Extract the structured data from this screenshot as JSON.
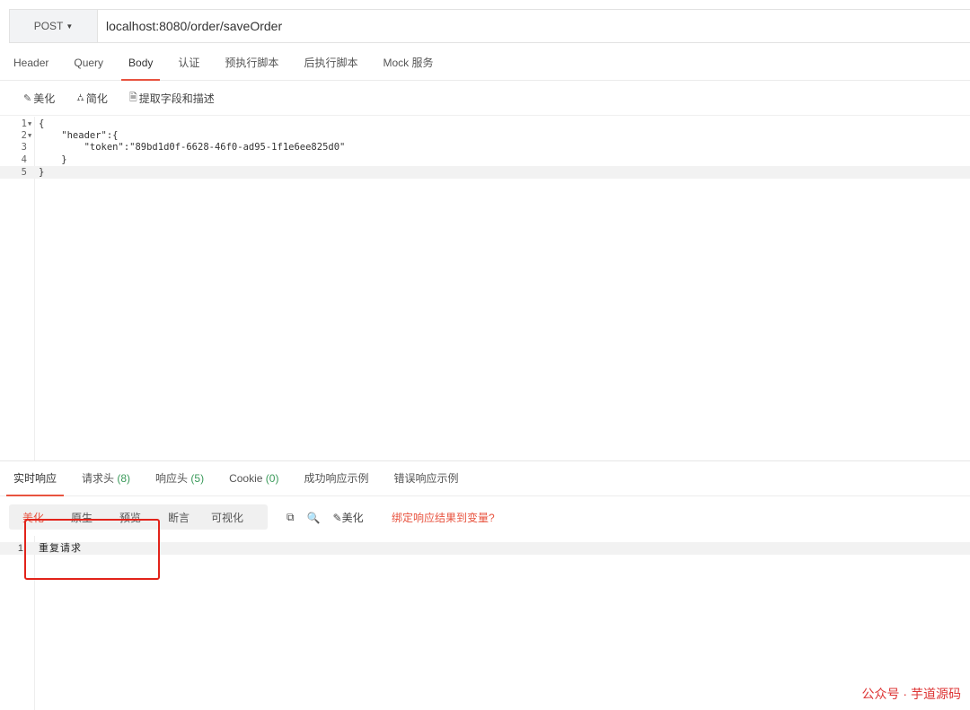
{
  "request": {
    "method": "POST",
    "url": "localhost:8080/order/saveOrder",
    "tabs": [
      {
        "label": "Header"
      },
      {
        "label": "Query"
      },
      {
        "label": "Body"
      },
      {
        "label": "认证"
      },
      {
        "label": "预执行脚本"
      },
      {
        "label": "后执行脚本"
      },
      {
        "label": "Mock 服务"
      }
    ],
    "active_tab": "Body"
  },
  "body_toolbar": {
    "beautify": "美化",
    "simplify": "简化",
    "extract": "提取字段和描述"
  },
  "editor": {
    "lines": [
      {
        "n": "1",
        "text": "{"
      },
      {
        "n": "2",
        "text": "    \"header\":{"
      },
      {
        "n": "3",
        "text": "        \"token\":\"89bd1d0f-6628-46f0-ad95-1f1e6ee825d0\""
      },
      {
        "n": "4",
        "text": "    }"
      },
      {
        "n": "5",
        "text": "}"
      }
    ]
  },
  "response": {
    "tabs": {
      "realtime": "实时响应",
      "req_headers": "请求头",
      "req_headers_count": "(8)",
      "resp_headers": "响应头",
      "resp_headers_count": "(5)",
      "cookie": "Cookie",
      "cookie_count": "(0)",
      "success_example": "成功响应示例",
      "error_example": "错误响应示例"
    },
    "view_modes": [
      "美化",
      "原生",
      "预览",
      "断言",
      "可视化"
    ],
    "active_view": "美化",
    "beautify_label": "美化",
    "bind_link": "绑定响应结果到变量?",
    "lines": [
      {
        "n": "1",
        "text": "重复请求"
      }
    ]
  },
  "watermark": "公众号 · 芋道源码",
  "colors": {
    "accent": "#e8533f",
    "highlight_box": "#e2231a",
    "count_green": "#3a9a5a"
  }
}
